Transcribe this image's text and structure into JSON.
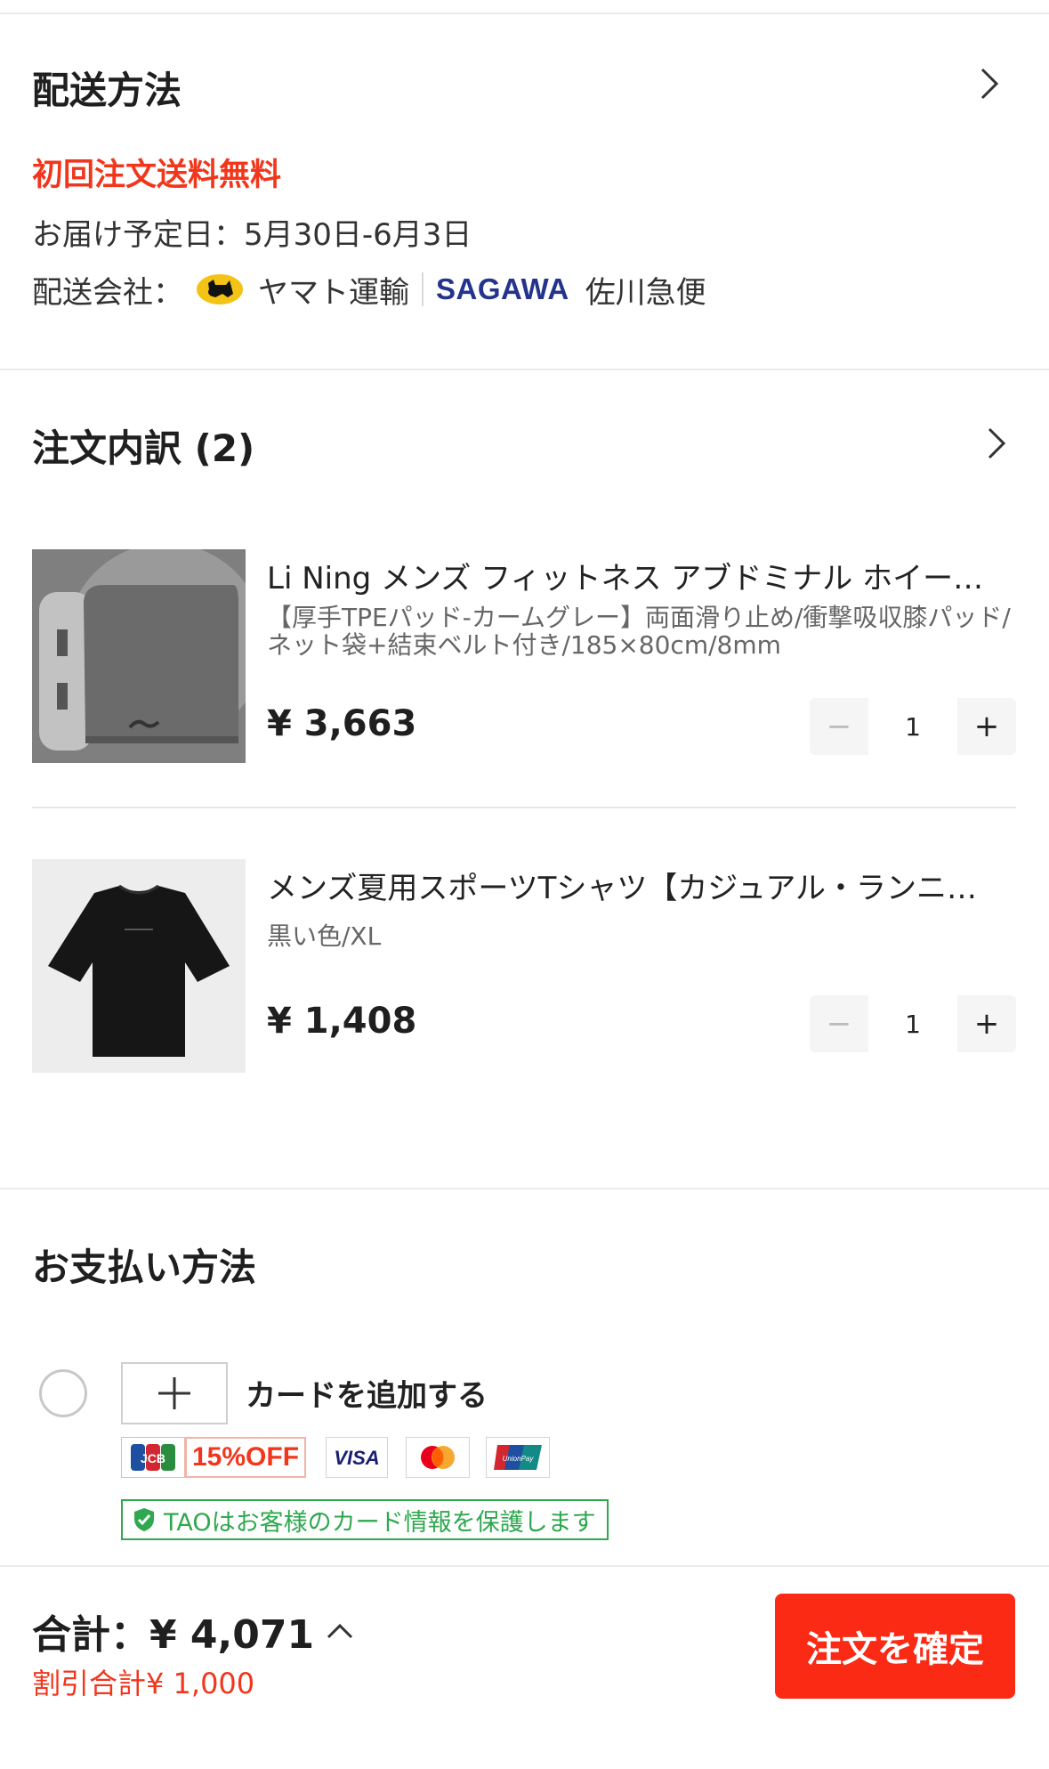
{
  "shipping": {
    "title": "配送方法",
    "free_shipping": "初回注文送料無料",
    "eta": "お届け予定日：5月30日-6月3日",
    "carrier_label": "配送会社：",
    "carrier1": "ヤマト運輸",
    "carrier2_logo": "SAGAWA",
    "carrier2": "佐川急便"
  },
  "order": {
    "title": "注文内訳 (2)",
    "items": [
      {
        "title": "Li Ning メンズ フィットネス アブドミナル ホイール…",
        "variant": "【厚手TPEパッド-カームグレー】両面滑り止め/衝撃吸収膝パッド/ネット袋+結束ベルト付き/185×80cm/8mm",
        "price": "¥ 3,663",
        "qty": "1",
        "minus": "−",
        "plus": "+"
      },
      {
        "title": "メンズ夏用スポーツTシャツ【カジュアル・ランニング…",
        "variant": "黒い色/XL",
        "price": "¥ 1,408",
        "qty": "1",
        "minus": "−",
        "plus": "+"
      }
    ]
  },
  "payment": {
    "title": "お支払い方法",
    "add_card": "カードを追加する",
    "promo": "15%OFF",
    "card_logos": [
      "JCB",
      "VISA",
      "Mastercard",
      "UnionPay"
    ],
    "jcb_text": "JCB",
    "visa_text": "VISA",
    "unionpay_text": "UnionPay",
    "secure_text": "TAOはお客様のカード情報を保護します"
  },
  "footer": {
    "total": "合計：¥ 4,071",
    "discount": "割引合計¥ 1,000",
    "confirm": "注文を確定"
  },
  "colors": {
    "accent": "#fa2a14",
    "red_text": "#f2361c",
    "secure_green": "#2fa84f",
    "sagawa_blue": "#24348c"
  }
}
